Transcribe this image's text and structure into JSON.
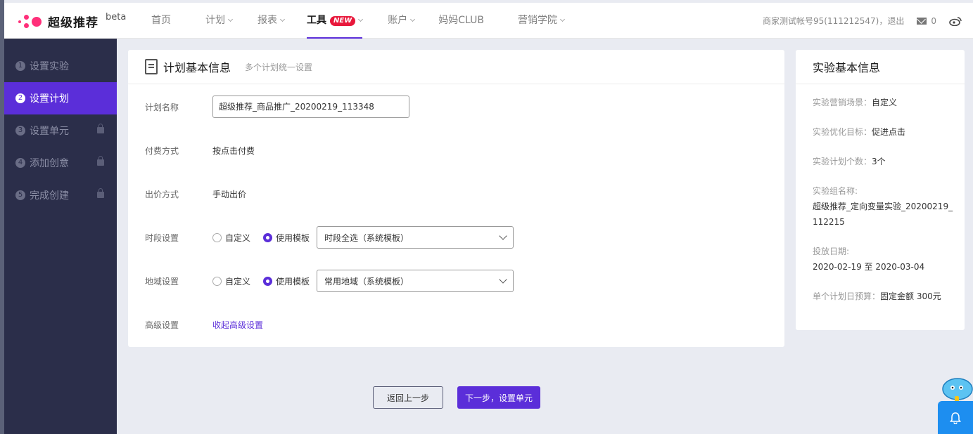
{
  "header": {
    "logo_text": "超级推荐",
    "logo_beta": "beta",
    "nav": [
      {
        "label": "首页"
      },
      {
        "label": "计划"
      },
      {
        "label": "报表"
      },
      {
        "label": "工具"
      },
      {
        "label": "账户"
      },
      {
        "label": "妈妈CLUB"
      },
      {
        "label": "营销学院"
      }
    ],
    "new_badge": "NEW",
    "account_text": "商家测试帐号95(111212547)，退出",
    "mail_count": "0"
  },
  "sidebar": {
    "steps": [
      {
        "num": "1",
        "label": "设置实验"
      },
      {
        "num": "2",
        "label": "设置计划"
      },
      {
        "num": "3",
        "label": "设置单元"
      },
      {
        "num": "4",
        "label": "添加创意"
      },
      {
        "num": "5",
        "label": "完成创建"
      }
    ]
  },
  "main": {
    "title": "计划基本信息",
    "subtitle": "多个计划统一设置",
    "plan_name_label": "计划名称",
    "plan_name_value": "超级推荐_商品推广_20200219_113348",
    "pay_label": "付费方式",
    "pay_value": "按点击付费",
    "bid_label": "出价方式",
    "bid_value": "手动出价",
    "time_label": "时段设置",
    "time_custom": "自定义",
    "time_template": "使用模板",
    "time_select": "时段全选（系统模板）",
    "region_label": "地域设置",
    "region_custom": "自定义",
    "region_template": "使用模板",
    "region_select": "常用地域（系统模板）",
    "advanced_label": "高级设置",
    "advanced_link": "收起高级设置"
  },
  "info": {
    "title": "实验基本信息",
    "scene_k": "实验营销场景：",
    "scene_v": "自定义",
    "goal_k": "实验优化目标：",
    "goal_v": "促进点击",
    "count_k": "实验计划个数：",
    "count_v": "3个",
    "group_k": "实验组名称:",
    "group_v": "超级推荐_定向变量实验_20200219_112215",
    "date_k": "投放日期:",
    "date_v": "2020-02-19 至 2020-03-04",
    "budget_k": "单个计划日预算：",
    "budget_v": "固定金额 300元"
  },
  "buttons": {
    "back": "返回上一步",
    "next": "下一步，设置单元"
  },
  "colors": {
    "accent": "#5b2ed9",
    "sidebar_bg": "#2b2e4a",
    "logo_pink": "#ff2f7a",
    "badge_red": "#e8173b"
  }
}
